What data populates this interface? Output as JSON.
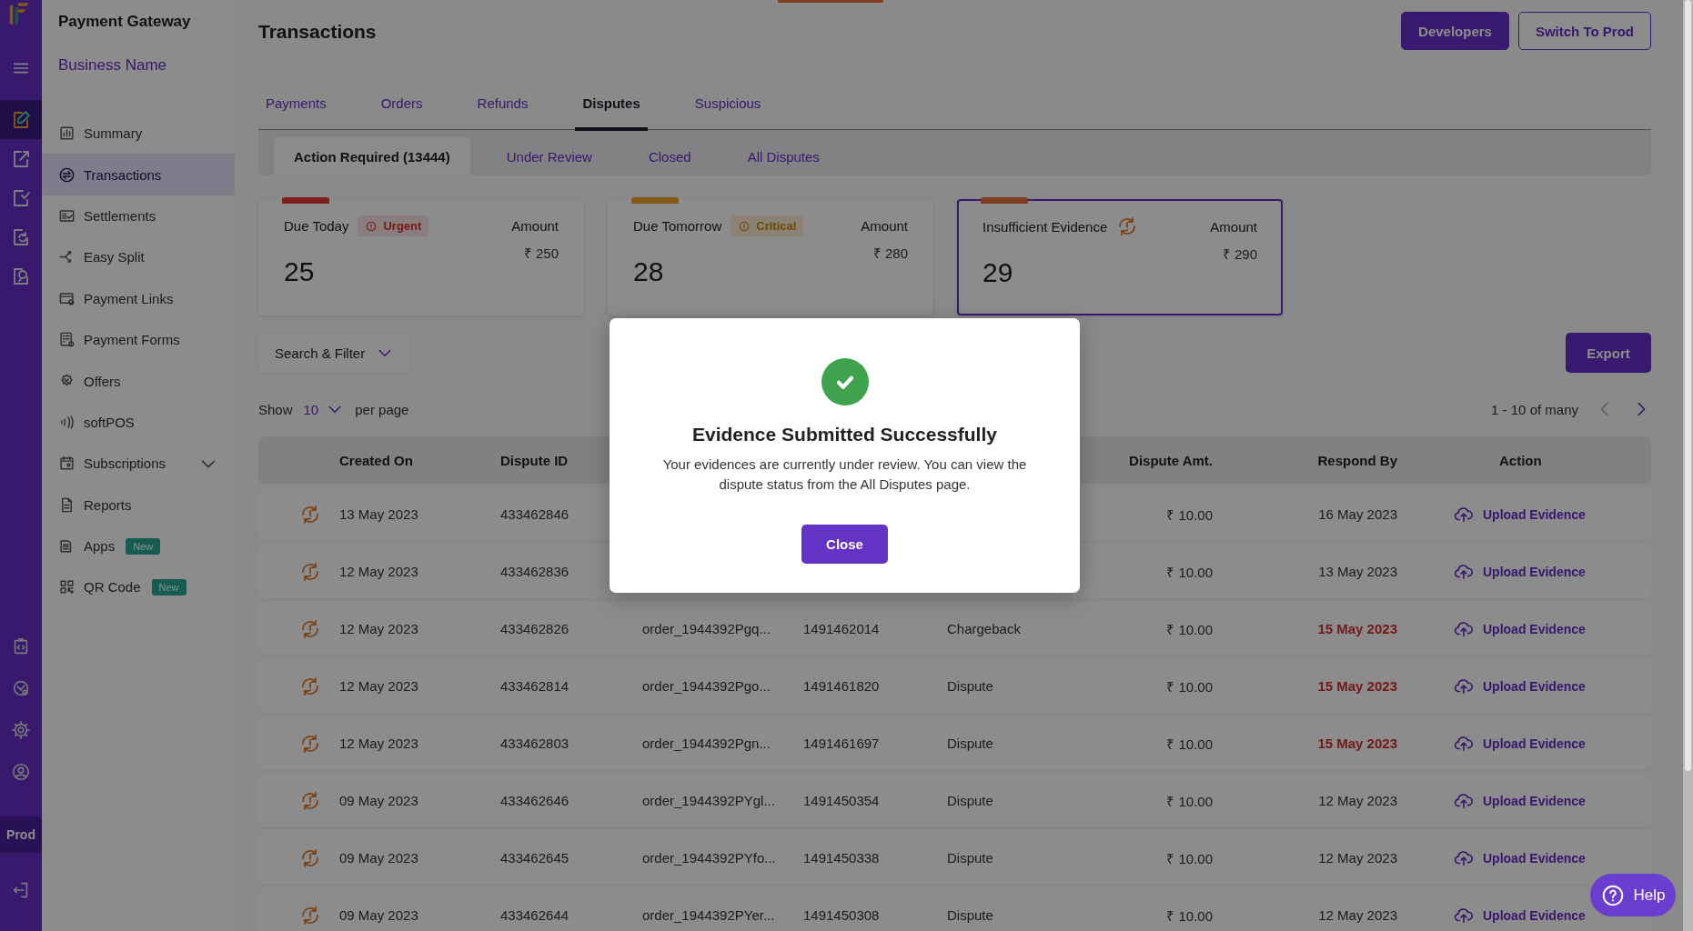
{
  "rail": {
    "items": [
      {
        "selected": true
      },
      {
        "selected": false
      },
      {
        "selected": false
      },
      {
        "selected": false
      },
      {
        "selected": false
      }
    ],
    "env_label": "Prod"
  },
  "sidebar": {
    "title": "Payment Gateway",
    "business": "Business Name",
    "items": [
      {
        "label": "Summary",
        "selected": false
      },
      {
        "label": "Transactions",
        "selected": true
      },
      {
        "label": "Settlements",
        "selected": false
      },
      {
        "label": "Easy Split",
        "selected": false
      },
      {
        "label": "Payment Links",
        "selected": false
      },
      {
        "label": "Payment Forms",
        "selected": false
      },
      {
        "label": "Offers",
        "selected": false
      },
      {
        "label": "softPOS",
        "selected": false
      },
      {
        "label": "Subscriptions",
        "selected": false,
        "expanded": false
      },
      {
        "label": "Reports",
        "selected": false
      },
      {
        "label": "Apps",
        "selected": false,
        "badge": "New"
      },
      {
        "label": "QR Code",
        "selected": false,
        "badge": "New"
      }
    ]
  },
  "header": {
    "title": "Transactions",
    "buttons": [
      {
        "label": "Developers",
        "kind": "primary"
      },
      {
        "label": "Switch To Prod",
        "kind": "outline"
      }
    ]
  },
  "tabs": [
    {
      "label": "Payments",
      "selected": false
    },
    {
      "label": "Orders",
      "selected": false
    },
    {
      "label": "Refunds",
      "selected": false
    },
    {
      "label": "Disputes",
      "selected": true
    },
    {
      "label": "Suspicious",
      "selected": false
    }
  ],
  "subtabs": [
    {
      "label": "Action Required (13444)",
      "selected": true
    },
    {
      "label": "Under Review",
      "selected": false
    },
    {
      "label": "Closed",
      "selected": false
    },
    {
      "label": "All Disputes",
      "selected": false
    }
  ],
  "cards": [
    {
      "title": "Due Today",
      "badge": {
        "text": "Urgent",
        "kind": "urgent"
      },
      "amount_label": "Amount",
      "amount": "₹ 250",
      "count": "25",
      "color": "#7e1f1d",
      "selected": false
    },
    {
      "title": "Due Tomorrow",
      "badge": {
        "text": "Critical",
        "kind": "critical"
      },
      "amount_label": "Amount",
      "amount": "₹ 280",
      "count": "28",
      "color": "#845917",
      "selected": false
    },
    {
      "title": "Insufficient Evidence",
      "amount_label": "Amount",
      "amount": "₹ 290",
      "count": "29",
      "color": "#803f20",
      "selected": true
    }
  ],
  "filter": {
    "label": "Search & Filter"
  },
  "export": {
    "label": "Export"
  },
  "page_size": {
    "prefix": "Show",
    "value": "10",
    "suffix": "per page"
  },
  "pager": {
    "text": "1 - 10 of many",
    "prev": {
      "disabled": true
    },
    "next": {
      "disabled": false
    }
  },
  "table": {
    "columns": [
      {
        "label": "Created On"
      },
      {
        "label": "Dispute ID"
      },
      {},
      {},
      {},
      {
        "label": "Dispute Amt."
      },
      {
        "label": "Respond By"
      },
      {
        "label": "Action"
      }
    ],
    "rows": [
      {
        "created": "13 May 2023",
        "dispute_id": "433462846",
        "amount": "₹ 10.00",
        "respond_by": "16 May 2023",
        "overdue": false,
        "action": "Upload Evidence"
      },
      {
        "created": "12 May 2023",
        "dispute_id": "433462836",
        "amount": "₹ 10.00",
        "respond_by": "13 May 2023",
        "overdue": false,
        "action": "Upload Evidence"
      },
      {
        "created": "12 May 2023",
        "dispute_id": "433462826",
        "order_id": "order_1944392Pgq...",
        "reference": "1491462014",
        "type": "Chargeback",
        "amount": "₹ 10.00",
        "respond_by": "15 May 2023",
        "overdue": true,
        "action": "Upload Evidence"
      },
      {
        "created": "12 May 2023",
        "dispute_id": "433462814",
        "order_id": "order_1944392Pgo...",
        "reference": "1491461820",
        "type": "Dispute",
        "amount": "₹ 10.00",
        "respond_by": "15 May 2023",
        "overdue": true,
        "action": "Upload Evidence"
      },
      {
        "created": "12 May 2023",
        "dispute_id": "433462803",
        "order_id": "order_1944392Pgn...",
        "reference": "1491461697",
        "type": "Dispute",
        "amount": "₹ 10.00",
        "respond_by": "15 May 2023",
        "overdue": true,
        "action": "Upload Evidence"
      },
      {
        "created": "09 May 2023",
        "dispute_id": "433462646",
        "order_id": "order_1944392PYgl...",
        "reference": "1491450354",
        "type": "Dispute",
        "amount": "₹ 10.00",
        "respond_by": "12 May 2023",
        "overdue": false,
        "action": "Upload Evidence"
      },
      {
        "created": "09 May 2023",
        "dispute_id": "433462645",
        "order_id": "order_1944392PYfo...",
        "reference": "1491450338",
        "type": "Dispute",
        "amount": "₹ 10.00",
        "respond_by": "12 May 2023",
        "overdue": false,
        "action": "Upload Evidence"
      },
      {
        "created": "09 May 2023",
        "dispute_id": "433462644",
        "order_id": "order_1944392PYer...",
        "reference": "1491450308",
        "type": "Dispute",
        "amount": "₹ 10.00",
        "respond_by": "12 May 2023",
        "overdue": false,
        "action": "Upload Evidence"
      }
    ]
  },
  "modal": {
    "title": "Evidence Submitted Successfully",
    "message": "Your evidences are currently under review. You can view the dispute status from the All Disputes page.",
    "button": "Close"
  },
  "help": {
    "label": "Help"
  }
}
